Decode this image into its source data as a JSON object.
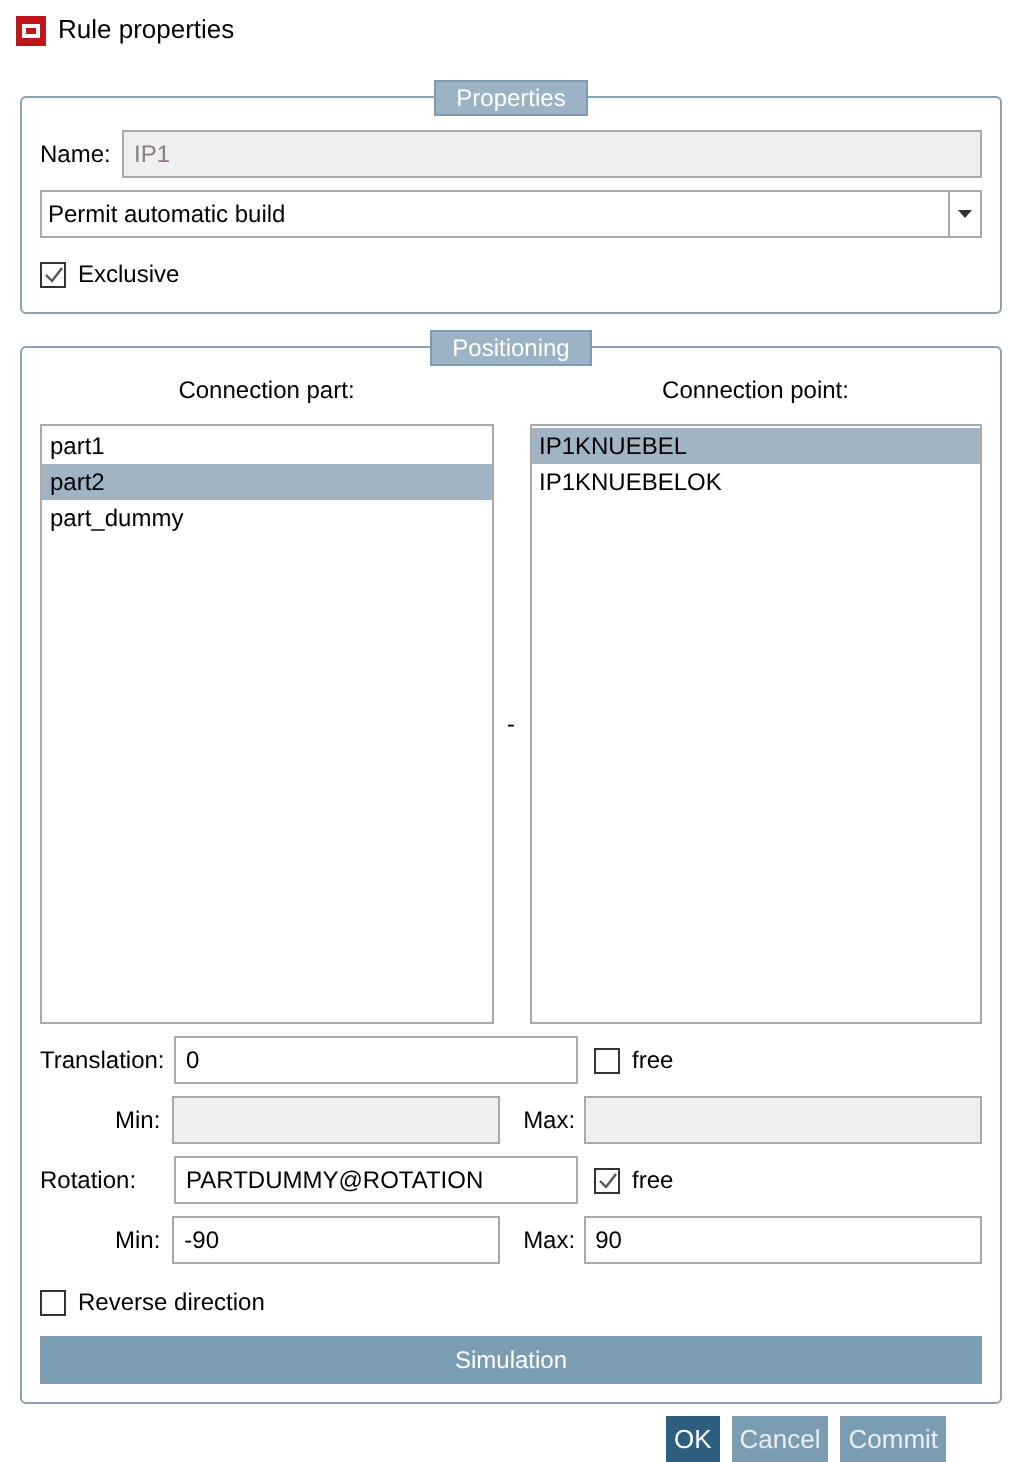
{
  "window": {
    "title": "Rule properties"
  },
  "properties": {
    "title": "Properties",
    "name": {
      "label": "Name:",
      "value": "IP1",
      "disabled": true
    },
    "build_mode": {
      "value": "Permit automatic build"
    },
    "exclusive": {
      "label": "Exclusive",
      "checked": true
    }
  },
  "positioning": {
    "title": "Positioning",
    "connection_part": {
      "label": "Connection part:",
      "items": [
        {
          "label": "part1",
          "selected": false
        },
        {
          "label": "part2",
          "selected": true
        },
        {
          "label": "part_dummy",
          "selected": false
        }
      ]
    },
    "separator": "-",
    "connection_point": {
      "label": "Connection point:",
      "items": [
        {
          "label": "IP1KNUEBEL",
          "selected": true
        },
        {
          "label": "IP1KNUEBELOK",
          "selected": false
        }
      ]
    },
    "translation": {
      "label": "Translation:",
      "value": "0",
      "free": {
        "label": "free",
        "checked": false
      },
      "min": {
        "label": "Min:",
        "disabled": true
      },
      "max": {
        "label": "Max:",
        "disabled": true
      }
    },
    "rotation": {
      "label": "Rotation:",
      "value": "PARTDUMMY@ROTATION",
      "free": {
        "label": "free",
        "checked": true
      },
      "min": {
        "label": "Min:",
        "value": "-90",
        "disabled": false
      },
      "max": {
        "label": "Max:",
        "value": "90",
        "disabled": false
      }
    },
    "reverse": {
      "label": "Reverse direction",
      "checked": false
    },
    "simulation": {
      "label": "Simulation"
    }
  },
  "buttons": [
    {
      "label": "OK",
      "kind": "primary"
    },
    {
      "label": "Cancel",
      "kind": "secondary"
    },
    {
      "label": "Commit",
      "kind": "secondary"
    }
  ]
}
